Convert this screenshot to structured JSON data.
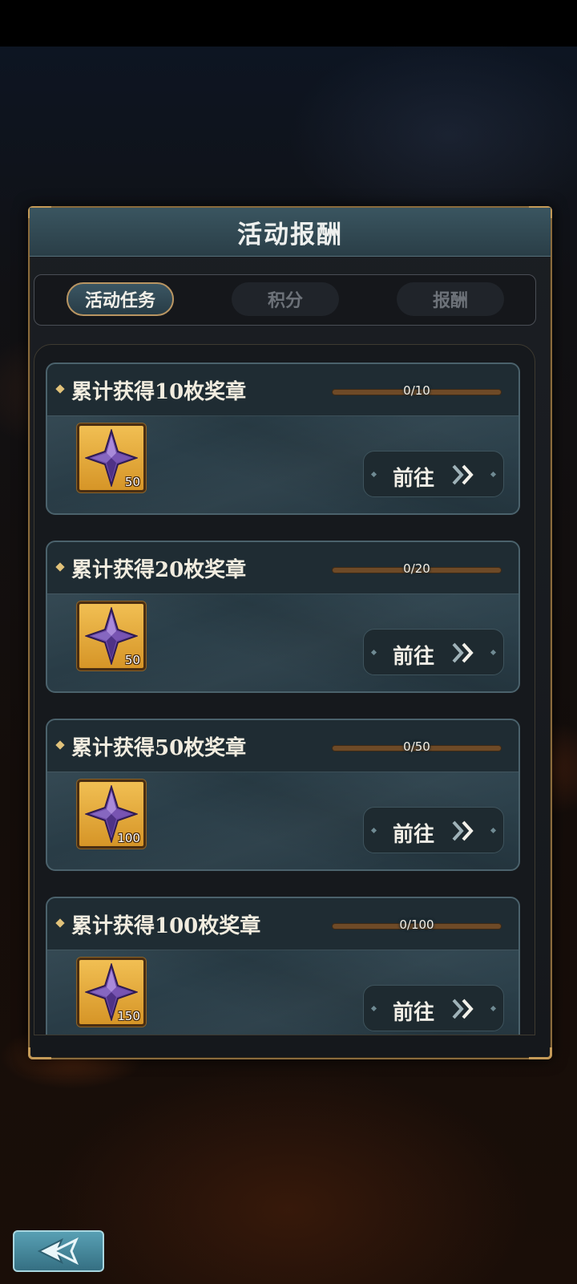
{
  "panel": {
    "title": "活动报酬"
  },
  "tabs": [
    {
      "label": "活动任务",
      "active": true
    },
    {
      "label": "积分",
      "active": false
    },
    {
      "label": "报酬",
      "active": false
    }
  ],
  "tasks": [
    {
      "title": "累计获得10枚奖章",
      "progress_text": "0/10",
      "progress": 0,
      "reward_icon": "purple-crystal-icon",
      "reward_count": "50",
      "action_label": "前往"
    },
    {
      "title": "累计获得20枚奖章",
      "progress_text": "0/20",
      "progress": 0,
      "reward_icon": "purple-crystal-icon",
      "reward_count": "50",
      "action_label": "前往"
    },
    {
      "title": "累计获得50枚奖章",
      "progress_text": "0/50",
      "progress": 0,
      "reward_icon": "purple-crystal-icon",
      "reward_count": "100",
      "action_label": "前往"
    },
    {
      "title": "累计获得100枚奖章",
      "progress_text": "0/100",
      "progress": 0,
      "reward_icon": "purple-crystal-icon",
      "reward_count": "150",
      "action_label": "前往"
    }
  ],
  "footer": {
    "back_icon": "back-arrow-icon"
  },
  "colors": {
    "accent_gold": "#c49a58",
    "progress_track": "#6e4a27",
    "button_teal": "#458a9e"
  }
}
